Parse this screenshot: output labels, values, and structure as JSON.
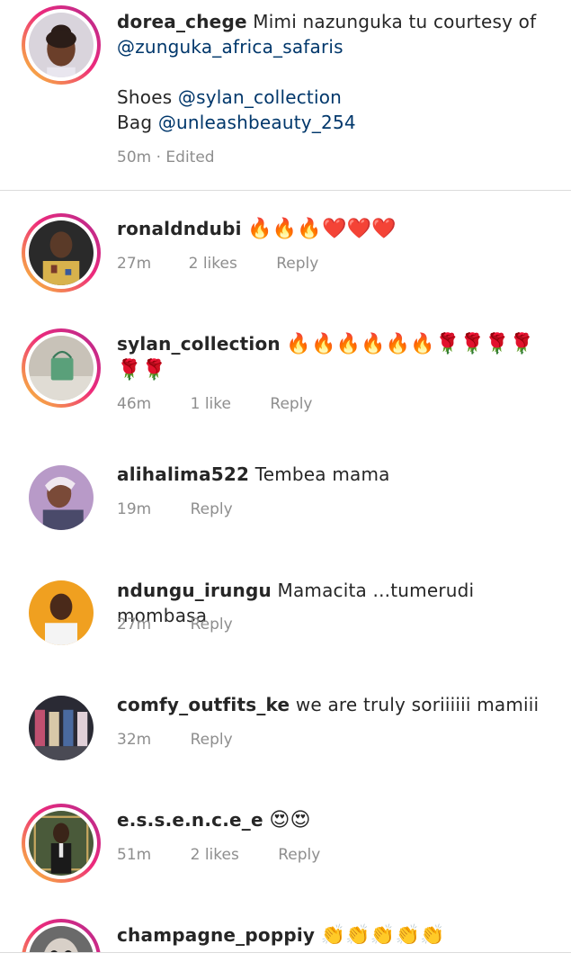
{
  "caption": {
    "username": "dorea_chege",
    "text": "Mimi nazunguka tu courtesy of",
    "mention1": "@zunguka_africa_safaris",
    "shoes_label": "Shoes",
    "mention2": "@sylan_collection",
    "bag_label": "Bag",
    "mention3": "@unleashbeauty_254",
    "time": "50m",
    "edited": "· Edited"
  },
  "comments": [
    {
      "username": "ronaldndubi",
      "text": "🔥🔥🔥❤️❤️❤️",
      "time": "27m",
      "likes": "2 likes",
      "reply": "Reply"
    },
    {
      "username": "sylan_collection",
      "text": "🔥🔥🔥🔥🔥🔥🌹🌹🌹🌹",
      "text2": "🌹🌹",
      "time": "46m",
      "likes": "1 like",
      "reply": "Reply"
    },
    {
      "username": "alihalima522",
      "text": "Tembea mama",
      "time": "19m",
      "reply": "Reply"
    },
    {
      "username": "ndungu_irungu",
      "text": "Mamacita ...tumerudi mombasa",
      "time": "27m",
      "reply": "Reply"
    },
    {
      "username": "comfy_outfits_ke",
      "text": "we are truly soriiiiii mamiii",
      "time": "32m",
      "reply": "Reply"
    },
    {
      "username": "e.s.s.e.n.c.e_e",
      "text": "😍😍",
      "time": "51m",
      "likes": "2 likes",
      "reply": "Reply"
    },
    {
      "username": "champagne_poppiy",
      "text": "👏👏👏👏👏"
    }
  ],
  "colors": {
    "mention": "#00376b",
    "meta": "#8e8e8e",
    "divider": "#dbdbdb"
  }
}
